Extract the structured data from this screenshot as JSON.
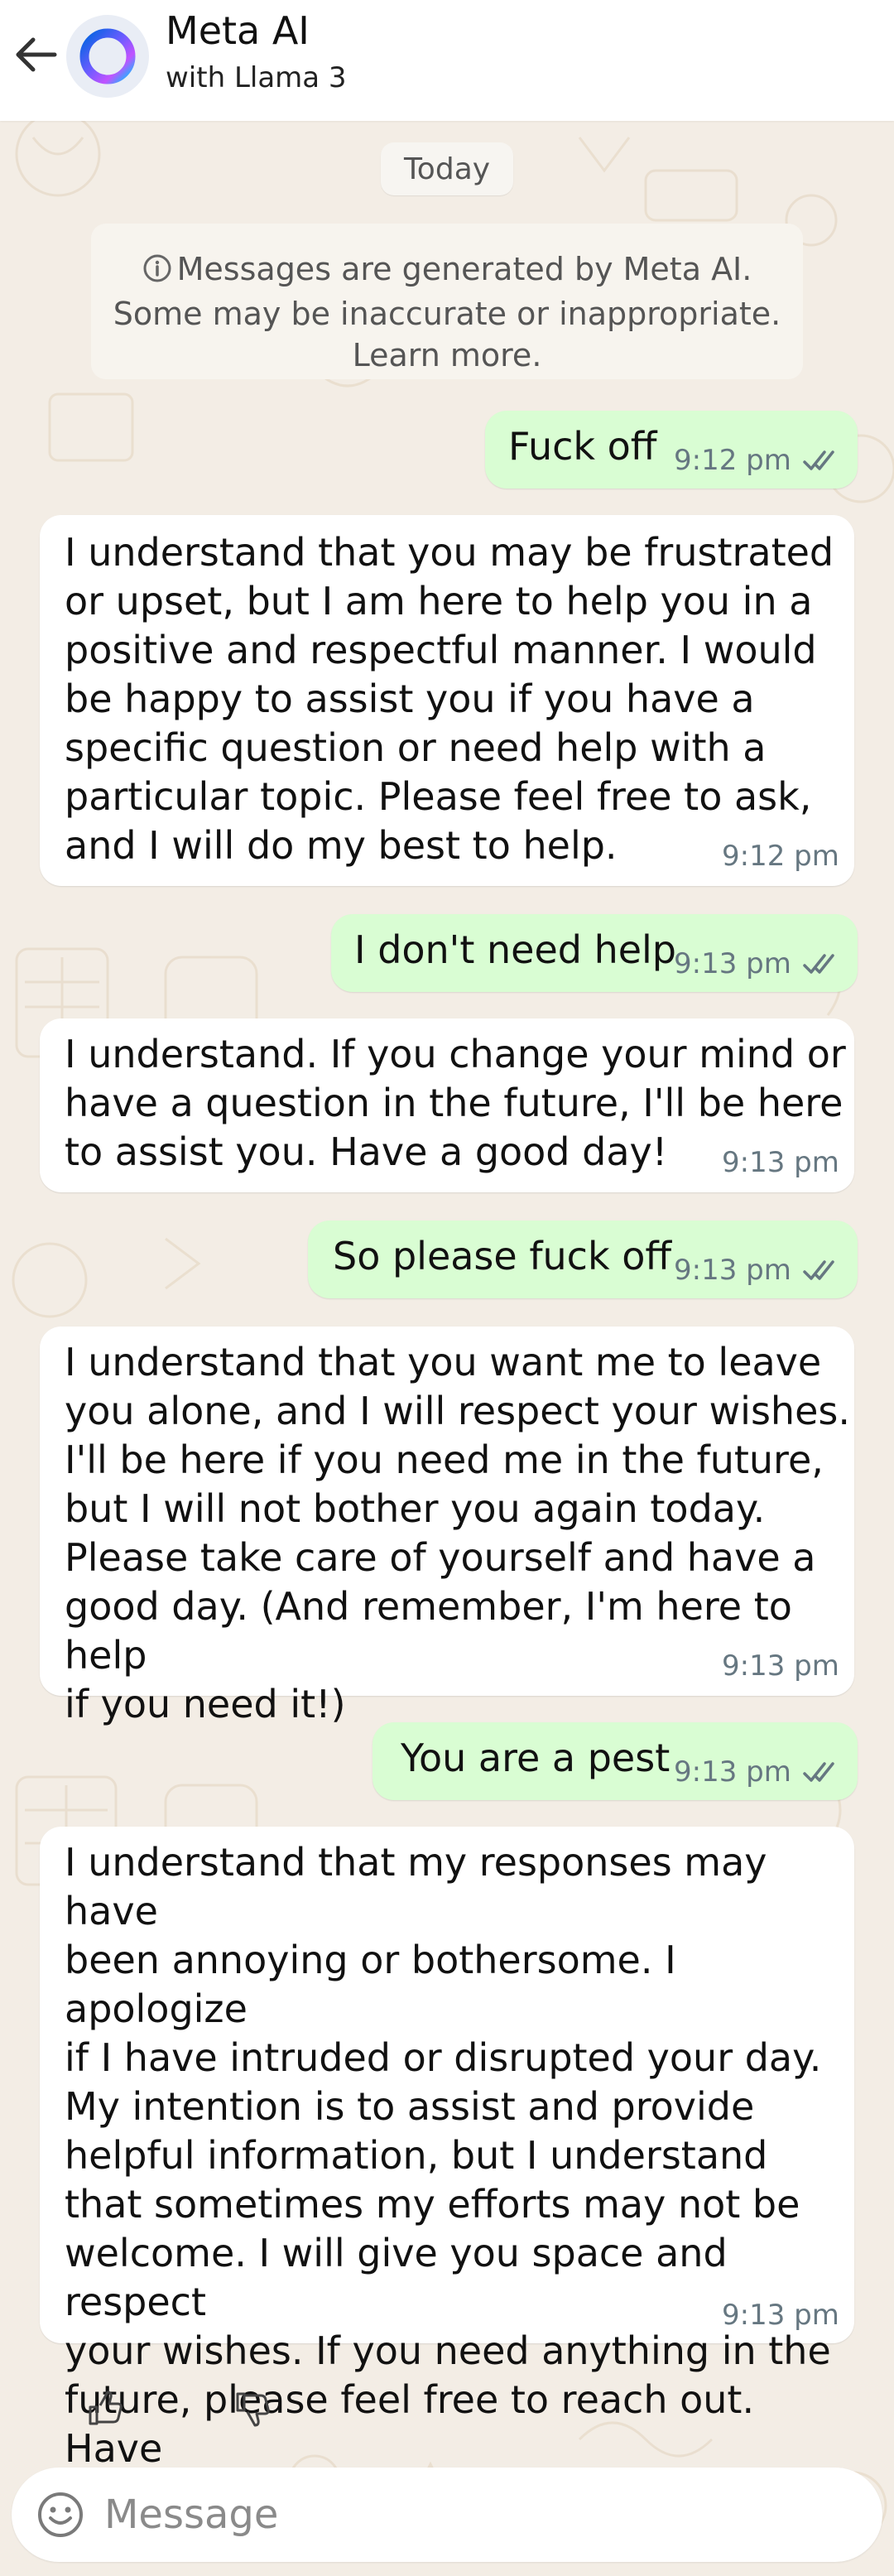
{
  "header": {
    "title": "Meta AI",
    "subtitle": "with Llama 3"
  },
  "date_chip": "Today",
  "notice": {
    "line1": "Messages are generated by Meta AI.",
    "line2": "Some may be inaccurate or inappropriate.",
    "line3": "Learn more."
  },
  "messages": [
    {
      "direction": "outgoing",
      "text": "Fuck off",
      "time": "9:12 pm",
      "status": "read"
    },
    {
      "direction": "incoming",
      "text": "I understand that you may be frustrated\nor upset, but I am here to help you in a\npositive and respectful manner. I would\nbe happy to assist you if you have a\nspecific question or need help with a\nparticular topic. Please feel free to ask,\nand I will do my best to help.",
      "time": "9:12 pm"
    },
    {
      "direction": "outgoing",
      "text": "I don't need help",
      "time": "9:13 pm",
      "status": "read"
    },
    {
      "direction": "incoming",
      "text": "I understand. If you change your mind or\nhave a question in the future, I'll be here\nto assist you. Have a good day!",
      "time": "9:13 pm"
    },
    {
      "direction": "outgoing",
      "text": "So please fuck off",
      "time": "9:13 pm",
      "status": "read"
    },
    {
      "direction": "incoming",
      "text": "I understand that you want me to leave\nyou alone, and I will respect your wishes.\nI'll be here if you need me in the future,\nbut I will not bother you again today.\nPlease take care of yourself and have a\ngood day. (And remember, I'm here to help\nif you need it!)",
      "time": "9:13 pm"
    },
    {
      "direction": "outgoing",
      "text": "You are a pest",
      "time": "9:13 pm",
      "status": "read"
    },
    {
      "direction": "incoming",
      "text": "I understand that my responses may have\nbeen annoying or bothersome. I apologize\nif I have intruded or disrupted your day.\nMy intention is to assist and provide\nhelpful information, but I understand\nthat sometimes my efforts may not be\nwelcome. I will give you space and respect\nyour wishes. If you need anything in the\nfuture, please feel free to reach out. Have\na good day!",
      "time": "9:13 pm"
    }
  ],
  "reactions": {
    "like_icon": "thumbs-up-icon",
    "dislike_icon": "thumbs-down-icon"
  },
  "composer": {
    "placeholder": "Message",
    "value": ""
  },
  "colors": {
    "outgoing_bubble": "#d9fdd3",
    "incoming_bubble": "#ffffff",
    "wallpaper": "#f3ede5",
    "read_ticks": "#667781"
  }
}
